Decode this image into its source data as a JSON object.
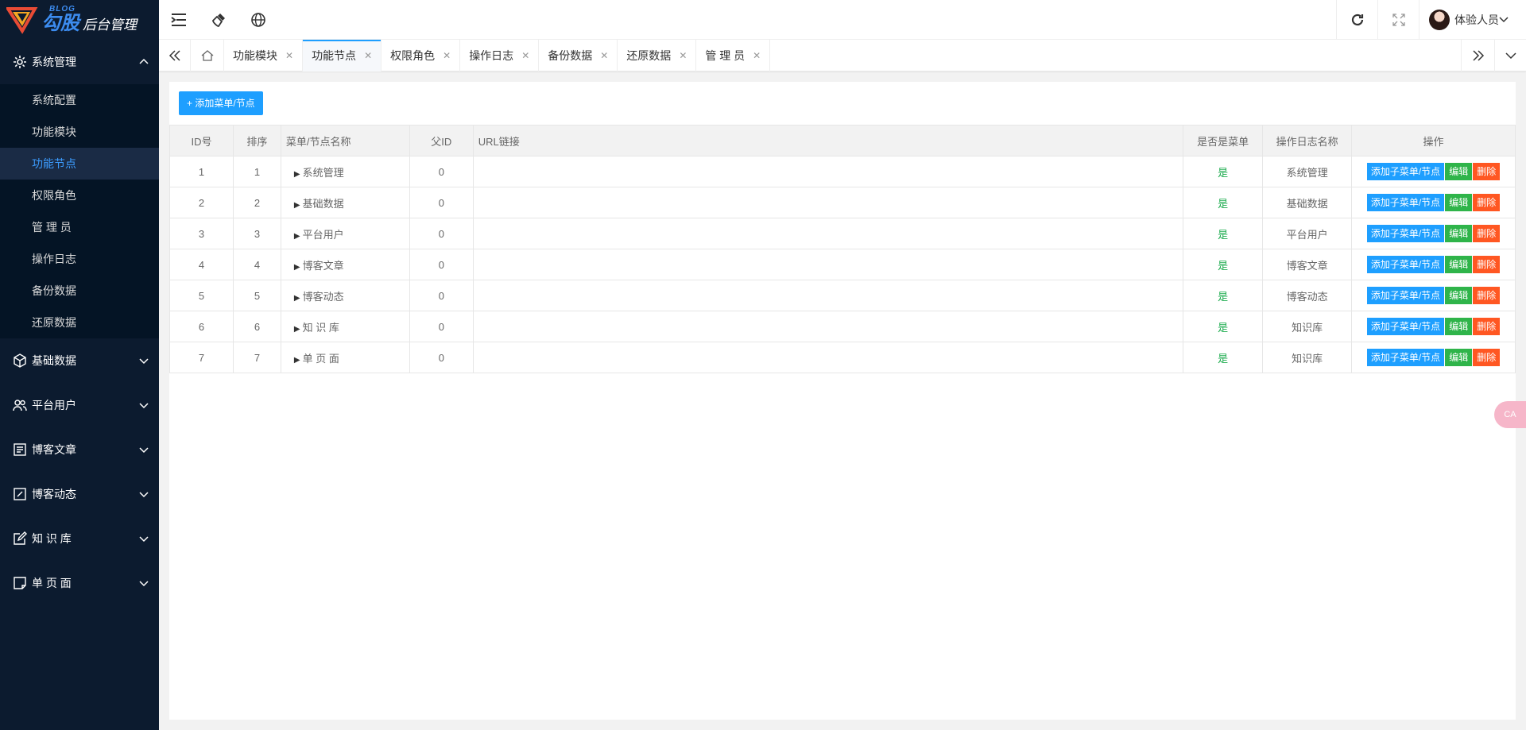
{
  "logo": {
    "blog": "BLOG",
    "main": "勾股",
    "sub": "后台管理"
  },
  "sidebar": {
    "groups": [
      {
        "label": "系统管理",
        "icon": "gear-icon",
        "expanded": true,
        "items": [
          "系统配置",
          "功能模块",
          "功能节点",
          "权限角色",
          "管 理 员",
          "操作日志",
          "备份数据",
          "还原数据"
        ],
        "active_item": "功能节点"
      },
      {
        "label": "基础数据",
        "icon": "cube-icon"
      },
      {
        "label": "平台用户",
        "icon": "users-icon"
      },
      {
        "label": "博客文章",
        "icon": "document-icon"
      },
      {
        "label": "博客动态",
        "icon": "edit-box-icon"
      },
      {
        "label": "知 识 库",
        "icon": "pencil-square-icon"
      },
      {
        "label": "单 页 面",
        "icon": "page-icon"
      }
    ]
  },
  "topbar": {
    "user_name": "体验人员"
  },
  "tabs": [
    "功能模块",
    "功能节点",
    "权限角色",
    "操作日志",
    "备份数据",
    "还原数据",
    "管 理 员"
  ],
  "active_tab": "功能节点",
  "toolbar": {
    "add_label": "+ 添加菜单/节点"
  },
  "table": {
    "headers": {
      "id": "ID号",
      "sort": "排序",
      "name": "菜单/节点名称",
      "pid": "父ID",
      "url": "URL链接",
      "is_menu": "是否是菜单",
      "log_name": "操作日志名称",
      "ops": "操作"
    },
    "rows": [
      {
        "id": "1",
        "sort": "1",
        "name": "系统管理",
        "pid": "0",
        "url": "",
        "is_menu": "是",
        "log_name": "系统管理"
      },
      {
        "id": "2",
        "sort": "2",
        "name": "基础数据",
        "pid": "0",
        "url": "",
        "is_menu": "是",
        "log_name": "基础数据"
      },
      {
        "id": "3",
        "sort": "3",
        "name": "平台用户",
        "pid": "0",
        "url": "",
        "is_menu": "是",
        "log_name": "平台用户"
      },
      {
        "id": "4",
        "sort": "4",
        "name": "博客文章",
        "pid": "0",
        "url": "",
        "is_menu": "是",
        "log_name": "博客文章"
      },
      {
        "id": "5",
        "sort": "5",
        "name": "博客动态",
        "pid": "0",
        "url": "",
        "is_menu": "是",
        "log_name": "博客动态"
      },
      {
        "id": "6",
        "sort": "6",
        "name": "知 识 库",
        "pid": "0",
        "url": "",
        "is_menu": "是",
        "log_name": "知识库"
      },
      {
        "id": "7",
        "sort": "7",
        "name": "单 页 面",
        "pid": "0",
        "url": "",
        "is_menu": "是",
        "log_name": "知识库"
      }
    ],
    "op_labels": {
      "add": "添加子菜单/节点",
      "edit": "编辑",
      "del": "删除"
    }
  },
  "float_badge": "CA",
  "colors": {
    "sidebar_bg": "#0c1b2f",
    "primary": "#1e9fff",
    "success": "#2fb44a",
    "danger": "#ff5722"
  }
}
